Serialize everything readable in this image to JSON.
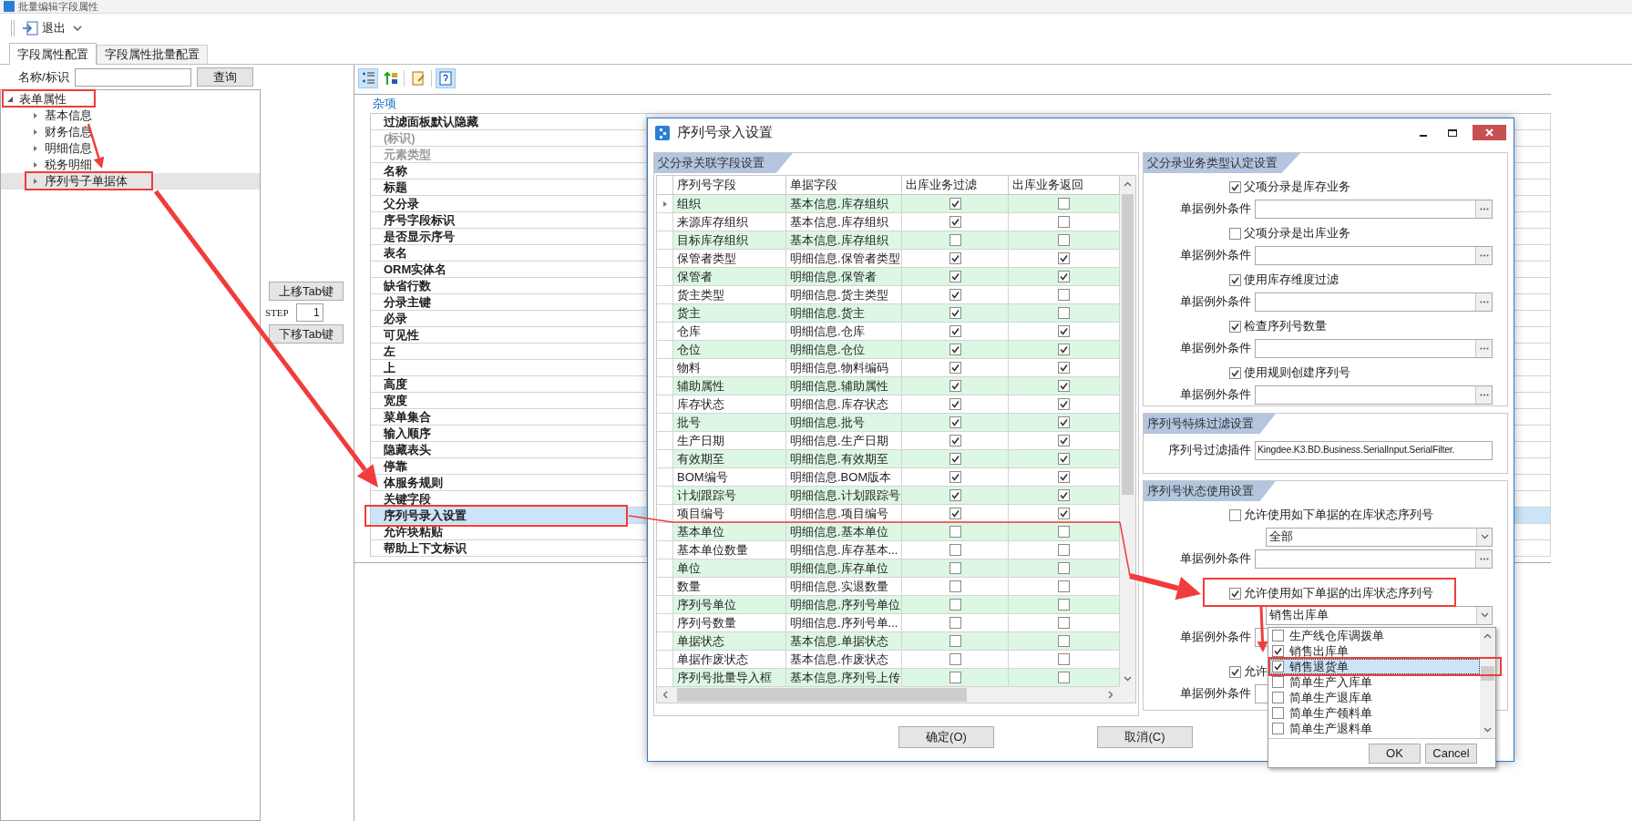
{
  "window": {
    "title": "批量编辑字段属性"
  },
  "toolbar": {
    "exit_label": "退出"
  },
  "tabs": [
    {
      "label": "字段属性配置",
      "selected": true
    },
    {
      "label": "字段属性批量配置",
      "selected": false
    }
  ],
  "search": {
    "label": "名称/标识",
    "button": "查询"
  },
  "tree": [
    {
      "label": "表单属性",
      "expanded": true,
      "selected": false,
      "children": [
        {
          "label": "基本信息",
          "expanded": false,
          "selected": false
        },
        {
          "label": "财务信息",
          "expanded": false,
          "selected": false
        },
        {
          "label": "明细信息",
          "expanded": false,
          "selected": false
        },
        {
          "label": "税务明细",
          "expanded": false,
          "selected": false
        },
        {
          "label": "序列号子单据体",
          "expanded": false,
          "selected": true
        }
      ]
    }
  ],
  "tab_order": {
    "up_button": "上移Tab键",
    "step_label": "STEP",
    "step_value": "1",
    "down_button": "下移Tab键"
  },
  "property_tools": [
    {
      "pressed": true
    },
    {
      "pressed": false
    },
    {
      "pressed": false
    },
    {
      "pressed": true
    }
  ],
  "property_grid": {
    "category": "杂项",
    "rows": [
      {
        "label": "过滤面板默认隐藏",
        "disabled": false,
        "selected": false
      },
      {
        "label": "(标识)",
        "disabled": true,
        "selected": false
      },
      {
        "label": "元素类型",
        "disabled": true,
        "selected": false
      },
      {
        "label": "名称",
        "disabled": false,
        "selected": false
      },
      {
        "label": "标题",
        "disabled": false,
        "selected": false
      },
      {
        "label": "父分录",
        "disabled": false,
        "selected": false
      },
      {
        "label": "序号字段标识",
        "disabled": false,
        "selected": false
      },
      {
        "label": "是否显示序号",
        "disabled": false,
        "selected": false
      },
      {
        "label": "表名",
        "disabled": false,
        "selected": false
      },
      {
        "label": "ORM实体名",
        "disabled": false,
        "selected": false
      },
      {
        "label": "缺省行数",
        "disabled": false,
        "selected": false
      },
      {
        "label": "分录主键",
        "disabled": false,
        "selected": false
      },
      {
        "label": "必录",
        "disabled": false,
        "selected": false
      },
      {
        "label": "可见性",
        "disabled": false,
        "selected": false
      },
      {
        "label": "左",
        "disabled": false,
        "selected": false
      },
      {
        "label": "上",
        "disabled": false,
        "selected": false
      },
      {
        "label": "高度",
        "disabled": false,
        "selected": false
      },
      {
        "label": "宽度",
        "disabled": false,
        "selected": false
      },
      {
        "label": "菜单集合",
        "disabled": false,
        "selected": false
      },
      {
        "label": "输入顺序",
        "disabled": false,
        "selected": false
      },
      {
        "label": "隐藏表头",
        "disabled": false,
        "selected": false
      },
      {
        "label": "停靠",
        "disabled": false,
        "selected": false
      },
      {
        "label": "体服务规则",
        "disabled": false,
        "selected": false
      },
      {
        "label": "关键字段",
        "disabled": false,
        "selected": false
      },
      {
        "label": "序列号录入设置",
        "disabled": false,
        "selected": true
      },
      {
        "label": "允许块粘贴",
        "disabled": false,
        "selected": false
      },
      {
        "label": "帮助上下文标识",
        "disabled": false,
        "selected": false
      }
    ]
  },
  "dialog": {
    "title": "序列号录入设置",
    "field_group": {
      "title": "父分录关联字段设置",
      "columns": [
        "序列号字段",
        "单据字段",
        "出库业务过滤",
        "出库业务返回"
      ],
      "rows": [
        {
          "serial_field": "组织",
          "bill_field": "基本信息.库存组织",
          "out_filter": true,
          "out_return": false,
          "current": true
        },
        {
          "serial_field": "来源库存组织",
          "bill_field": "基本信息.库存组织",
          "out_filter": true,
          "out_return": false,
          "current": false
        },
        {
          "serial_field": "目标库存组织",
          "bill_field": "基本信息.库存组织",
          "out_filter": false,
          "out_return": false,
          "current": false
        },
        {
          "serial_field": "保管者类型",
          "bill_field": "明细信息.保管者类型",
          "out_filter": true,
          "out_return": true,
          "current": false
        },
        {
          "serial_field": "保管者",
          "bill_field": "明细信息.保管者",
          "out_filter": true,
          "out_return": true,
          "current": false
        },
        {
          "serial_field": "货主类型",
          "bill_field": "明细信息.货主类型",
          "out_filter": true,
          "out_return": false,
          "current": false
        },
        {
          "serial_field": "货主",
          "bill_field": "明细信息.货主",
          "out_filter": true,
          "out_return": false,
          "current": false
        },
        {
          "serial_field": "仓库",
          "bill_field": "明细信息.仓库",
          "out_filter": true,
          "out_return": true,
          "current": false
        },
        {
          "serial_field": "仓位",
          "bill_field": "明细信息.仓位",
          "out_filter": true,
          "out_return": true,
          "current": false
        },
        {
          "serial_field": "物料",
          "bill_field": "明细信息.物料编码",
          "out_filter": true,
          "out_return": true,
          "current": false
        },
        {
          "serial_field": "辅助属性",
          "bill_field": "明细信息.辅助属性",
          "out_filter": true,
          "out_return": true,
          "current": false
        },
        {
          "serial_field": "库存状态",
          "bill_field": "明细信息.库存状态",
          "out_filter": true,
          "out_return": true,
          "current": false
        },
        {
          "serial_field": "批号",
          "bill_field": "明细信息.批号",
          "out_filter": true,
          "out_return": true,
          "current": false
        },
        {
          "serial_field": "生产日期",
          "bill_field": "明细信息.生产日期",
          "out_filter": true,
          "out_return": true,
          "current": false
        },
        {
          "serial_field": "有效期至",
          "bill_field": "明细信息.有效期至",
          "out_filter": true,
          "out_return": true,
          "current": false
        },
        {
          "serial_field": "BOM编号",
          "bill_field": "明细信息.BOM版本",
          "out_filter": true,
          "out_return": true,
          "current": false
        },
        {
          "serial_field": "计划跟踪号",
          "bill_field": "明细信息.计划跟踪号",
          "out_filter": true,
          "out_return": true,
          "current": false
        },
        {
          "serial_field": "项目编号",
          "bill_field": "明细信息.项目编号",
          "out_filter": true,
          "out_return": true,
          "current": false
        },
        {
          "serial_field": "基本单位",
          "bill_field": "明细信息.基本单位",
          "out_filter": false,
          "out_return": false,
          "current": false
        },
        {
          "serial_field": "基本单位数量",
          "bill_field": "明细信息.库存基本...",
          "out_filter": false,
          "out_return": false,
          "current": false
        },
        {
          "serial_field": "单位",
          "bill_field": "明细信息.库存单位",
          "out_filter": false,
          "out_return": false,
          "current": false
        },
        {
          "serial_field": "数量",
          "bill_field": "明细信息.实退数量",
          "out_filter": false,
          "out_return": false,
          "current": false
        },
        {
          "serial_field": "序列号单位",
          "bill_field": "明细信息.序列号单位",
          "out_filter": false,
          "out_return": false,
          "current": false
        },
        {
          "serial_field": "序列号数量",
          "bill_field": "明细信息.序列号单...",
          "out_filter": false,
          "out_return": false,
          "current": false
        },
        {
          "serial_field": "单据状态",
          "bill_field": "基本信息.单据状态",
          "out_filter": false,
          "out_return": false,
          "current": false
        },
        {
          "serial_field": "单据作废状态",
          "bill_field": "基本信息.作废状态",
          "out_filter": false,
          "out_return": false,
          "current": false
        },
        {
          "serial_field": "序列号批量导入框",
          "bill_field": "基本信息.序列号上传",
          "out_filter": false,
          "out_return": false,
          "current": false
        }
      ]
    },
    "setting_groups": [
      {
        "title": "父分录业务类型认定设置",
        "rows": [
          {
            "kind": "checkbox",
            "label": "父项分录是库存业务",
            "checked": true
          },
          {
            "kind": "condition",
            "label": "单据例外条件"
          },
          {
            "kind": "checkbox",
            "label": "父项分录是出库业务",
            "checked": false
          },
          {
            "kind": "condition",
            "label": "单据例外条件"
          },
          {
            "kind": "checkbox",
            "label": "使用库存维度过滤",
            "checked": true
          },
          {
            "kind": "condition",
            "label": "单据例外条件"
          },
          {
            "kind": "checkbox",
            "label": "检查序列号数量",
            "checked": true
          },
          {
            "kind": "condition",
            "label": "单据例外条件"
          },
          {
            "kind": "checkbox",
            "label": "使用规则创建序列号",
            "checked": true
          },
          {
            "kind": "condition",
            "label": "单据例外条件"
          }
        ]
      },
      {
        "title": "序列号特殊过滤设置",
        "rows": [
          {
            "kind": "plugin",
            "label": "序列号过滤插件",
            "value": "Kingdee.K3.BD.Business.SerialInput.SerialFilter."
          }
        ]
      },
      {
        "title": "序列号状态使用设置",
        "rows": [
          {
            "kind": "checkbox",
            "label": "允许使用如下单据的在库状态序列号",
            "checked": false
          },
          {
            "kind": "dropdown",
            "value": "全部"
          },
          {
            "kind": "condition",
            "label": "单据例外条件"
          },
          {
            "kind": "checkbox",
            "label": "允许使用如下单据的出库状态序列号",
            "checked": true
          },
          {
            "kind": "dropdown",
            "value": "销售出库单"
          },
          {
            "kind": "condition",
            "label": "单据例外条件"
          },
          {
            "kind": "checkbox",
            "label": "允许",
            "checked": true
          },
          {
            "kind": "condition",
            "label": "单据例外条件"
          }
        ]
      }
    ],
    "buttons": [
      "确定(O)",
      "取消(C)"
    ],
    "popup": {
      "items": [
        {
          "label": "生产线仓库调拨单",
          "checked": false,
          "selected": false
        },
        {
          "label": "销售出库单",
          "checked": true,
          "selected": false
        },
        {
          "label": "销售退货单",
          "checked": true,
          "selected": true
        },
        {
          "label": "简单生产入库单",
          "checked": false,
          "selected": false
        },
        {
          "label": "简单生产退库单",
          "checked": false,
          "selected": false
        },
        {
          "label": "简单生产领料单",
          "checked": false,
          "selected": false
        },
        {
          "label": "简单生产退料单",
          "checked": false,
          "selected": false
        }
      ],
      "buttons": [
        "OK",
        "Cancel"
      ]
    }
  }
}
